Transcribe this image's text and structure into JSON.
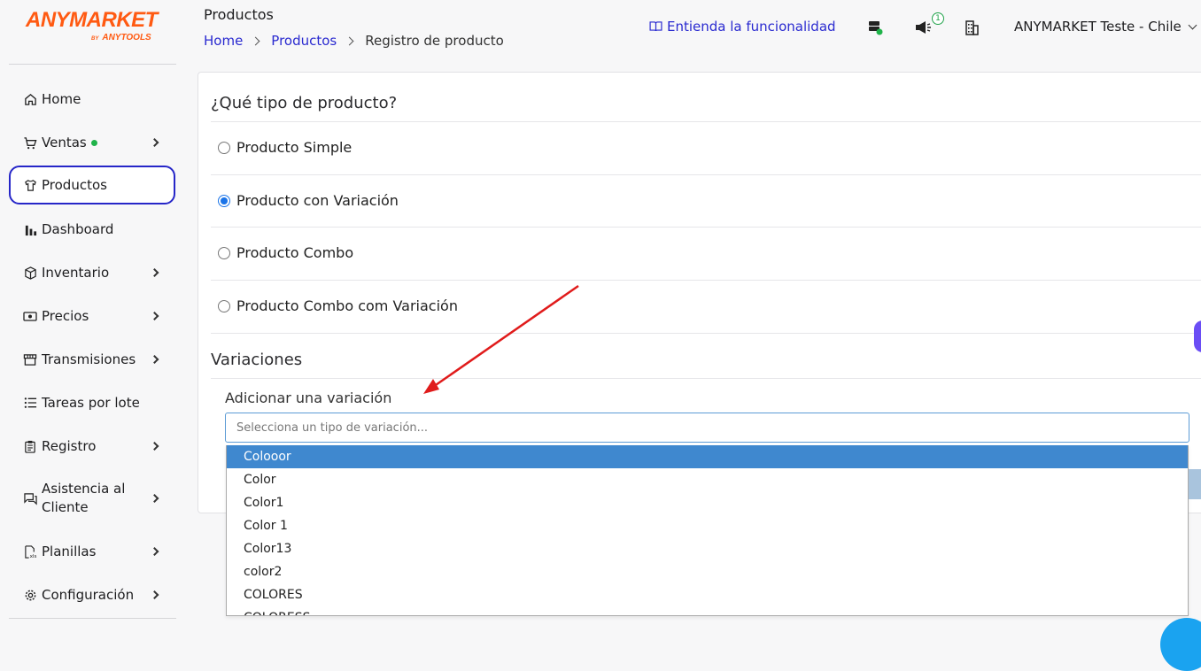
{
  "brand": {
    "logo_text": "ANYMARKET",
    "logo_by": "BY",
    "logo_sub": "ANYTOOLS",
    "accent": "#ff5a12"
  },
  "sidebar": {
    "items": [
      {
        "label": "Home",
        "icon": "home-icon"
      },
      {
        "label": "Ventas",
        "icon": "cart-icon",
        "has_dot": true
      },
      {
        "label": "Productos",
        "icon": "shirt-icon",
        "active": true
      },
      {
        "label": "Dashboard",
        "icon": "bar-chart-icon"
      },
      {
        "label": "Inventario",
        "icon": "box-icon"
      },
      {
        "label": "Precios",
        "icon": "money-icon"
      },
      {
        "label": "Transmisiones",
        "icon": "store-icon"
      },
      {
        "label": "Tareas por lote",
        "icon": "list-icon"
      },
      {
        "label": "Registro",
        "icon": "clipboard-icon"
      },
      {
        "label": "Asistencia al Cliente",
        "icon": "chat-icon"
      },
      {
        "label": "Planillas",
        "icon": "spreadsheet-icon"
      },
      {
        "label": "Configuración",
        "icon": "gear-icon"
      }
    ]
  },
  "header": {
    "title": "Productos",
    "breadcrumb": [
      "Home",
      "Productos",
      "Registro de producto"
    ],
    "help_link": "Entienda la funcionalidad",
    "notification_count": "1",
    "account_name": "ANYMARKET Teste - Chile"
  },
  "form": {
    "product_type_title": "¿Qué tipo de producto?",
    "options": [
      {
        "label": "Producto Simple",
        "checked": false
      },
      {
        "label": "Producto con Variación",
        "checked": true
      },
      {
        "label": "Producto Combo",
        "checked": false
      },
      {
        "label": "Producto Combo com Variación",
        "checked": false
      }
    ],
    "variations_title": "Variaciones",
    "add_variation_label": "Adicionar una variación",
    "select_placeholder": "Selecciona un tipo de variación...",
    "dropdown_options": [
      "Colooor",
      "Color",
      "Color1",
      "Color 1",
      "Color13",
      "color2",
      "COLORES",
      "COLORESS"
    ],
    "highlighted_option": "Colooor"
  },
  "colors": {
    "link": "#2a2ad0",
    "active_border": "#2626c8",
    "highlight": "#3f88cf",
    "arrow": "#e01b1b"
  }
}
